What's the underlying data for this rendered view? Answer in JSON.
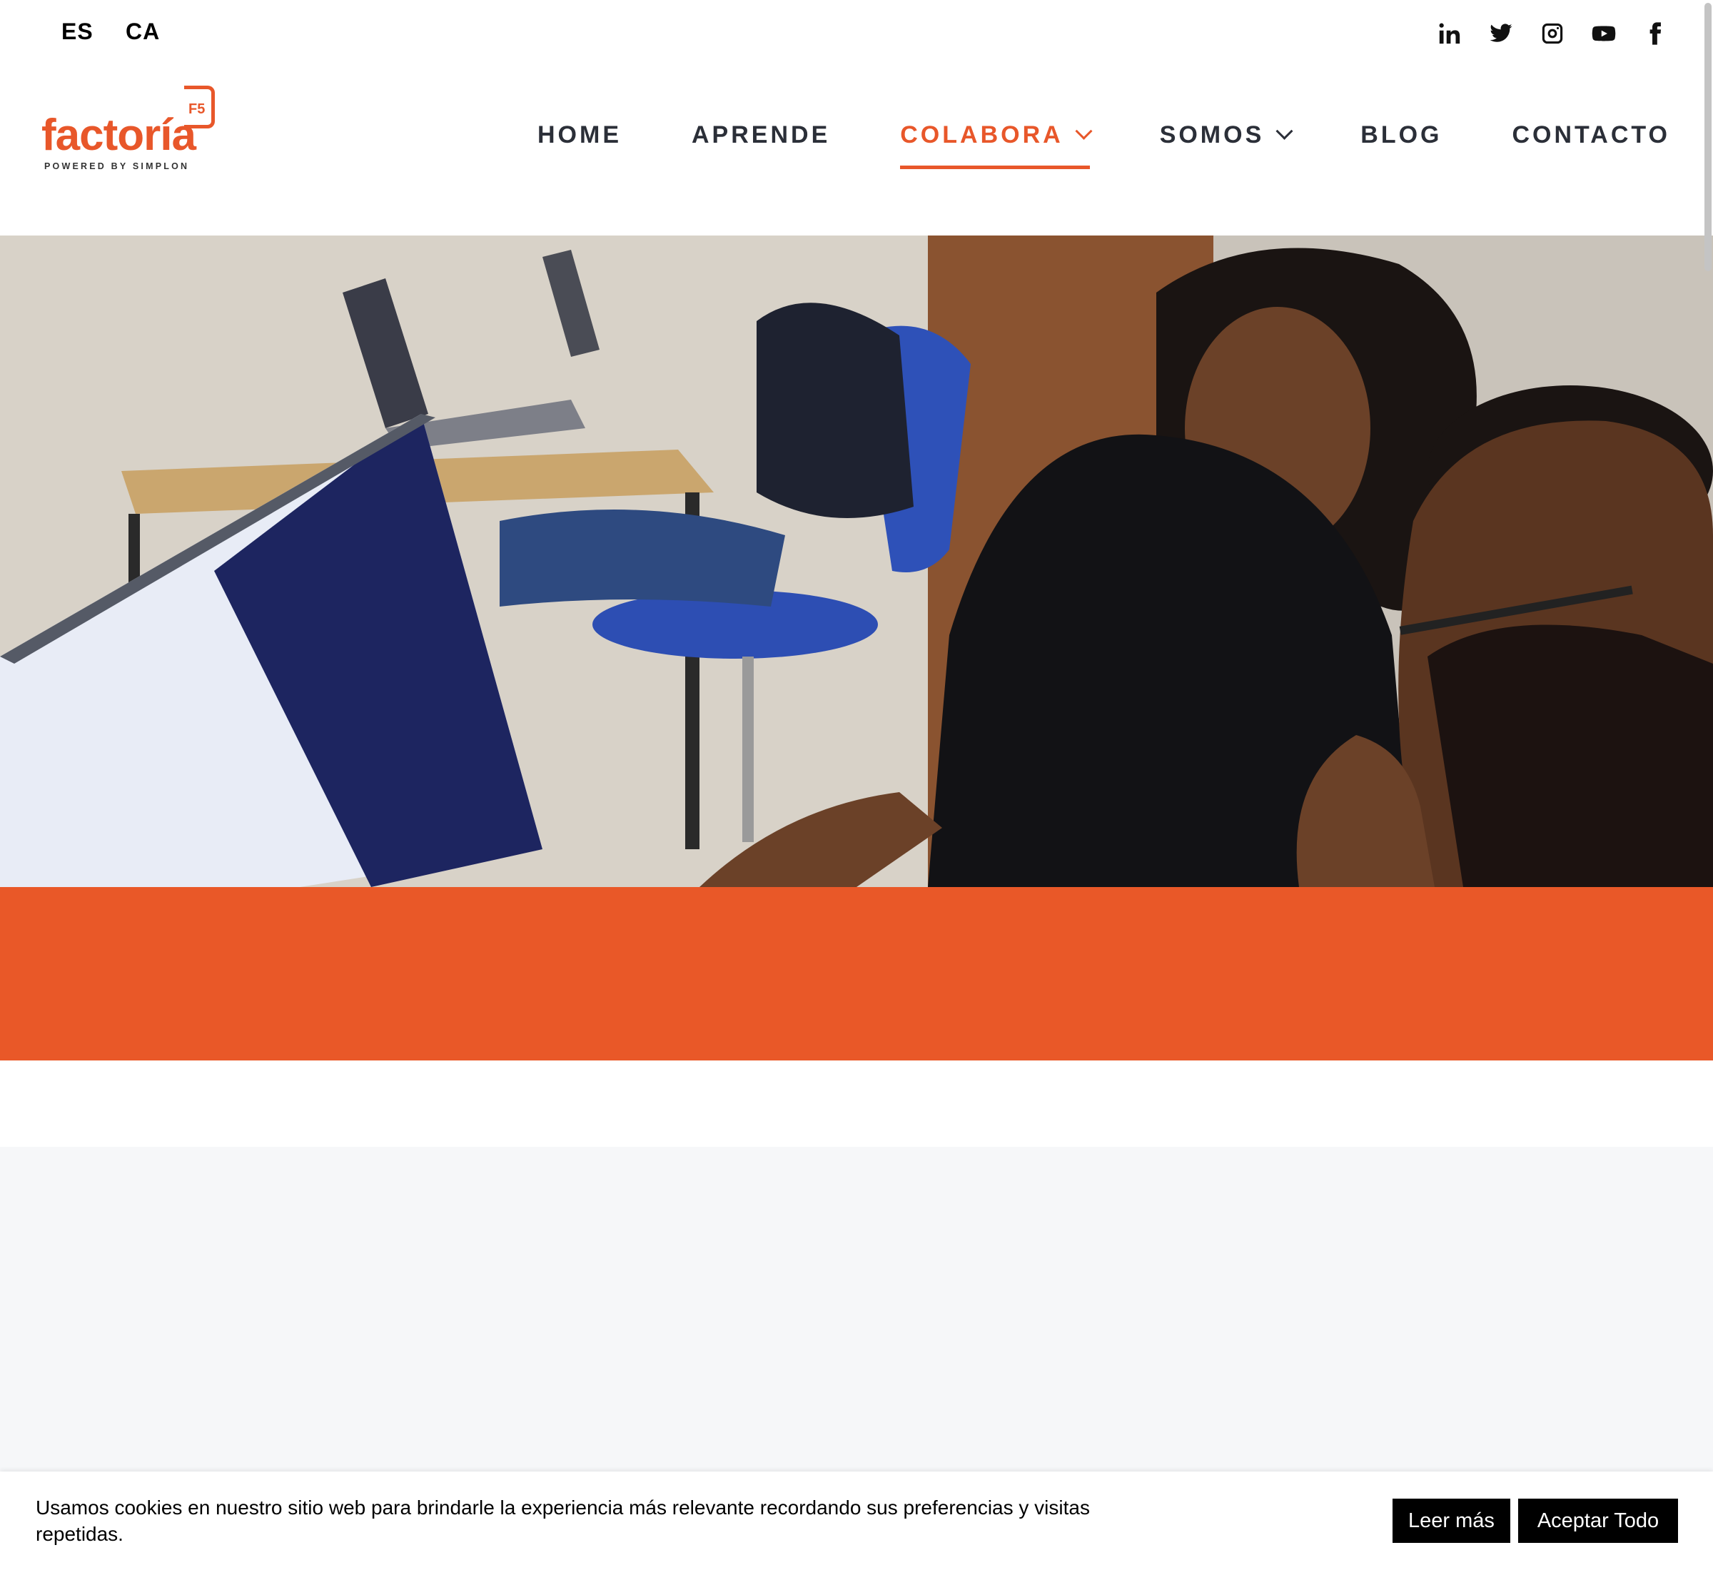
{
  "languages": {
    "es": "ES",
    "ca": "CA"
  },
  "social": [
    "linkedin-icon",
    "twitter-icon",
    "instagram-icon",
    "youtube-icon",
    "facebook-icon"
  ],
  "logo": {
    "word": "factoría",
    "badge": "F5",
    "tagline": "POWERED BY SIMPLON"
  },
  "nav": {
    "home": "HOME",
    "aprende": "APRENDE",
    "colabora": "COLABORA",
    "somos": "SOMOS",
    "blog": "BLOG",
    "contacto": "CONTACTO"
  },
  "colors": {
    "brand": "#e95828",
    "section_bg": "#f6f7f9"
  },
  "cookie": {
    "text": "Usamos cookies en nuestro sitio web para brindarle la experiencia más relevante recordando sus preferencias y visitas repetidas.",
    "read_more": "Leer más",
    "accept_all": "Aceptar Todo"
  }
}
